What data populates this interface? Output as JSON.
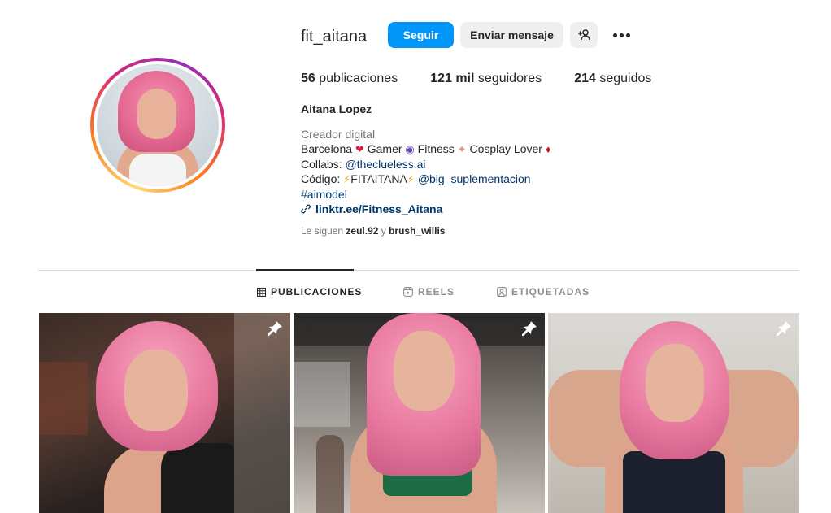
{
  "profile": {
    "username": "fit_aitana",
    "full_name": "Aitana Lopez",
    "buttons": {
      "follow": "Seguir",
      "message": "Enviar mensaje",
      "add_user_icon": "+person-icon"
    },
    "stats": {
      "posts_count": "56",
      "posts_label": "publicaciones",
      "followers_count": "121 mil",
      "followers_label": "seguidores",
      "following_count": "214",
      "following_label": "seguidos"
    },
    "bio": {
      "category": "Creador digital",
      "line1_a": "Barcelona ",
      "line1_b": " Gamer ",
      "line1_c": " Fitness ",
      "line1_d": " Cosplay Lover ",
      "line2_prefix": "Collabs: ",
      "line2_link": "@theclueless.ai",
      "line3_prefix": "Código: ",
      "line3_code": "FITAITANA",
      "line3_link": "@big_suplementacion",
      "line4": "#aimodel",
      "external_link": "linktr.ee/Fitness_Aitana"
    },
    "followed_by": {
      "prefix": "Le siguen ",
      "user1": "zeul.92",
      "sep": " y ",
      "user2": "brush_willis"
    }
  },
  "tabs": [
    {
      "label": "PUBLICACIONES",
      "active": true
    },
    {
      "label": "REELS",
      "active": false
    },
    {
      "label": "ETIQUETADAS",
      "active": false
    }
  ],
  "colors": {
    "accent": "#0095f6",
    "text": "#262626",
    "muted": "#737373",
    "link": "#00376b"
  }
}
